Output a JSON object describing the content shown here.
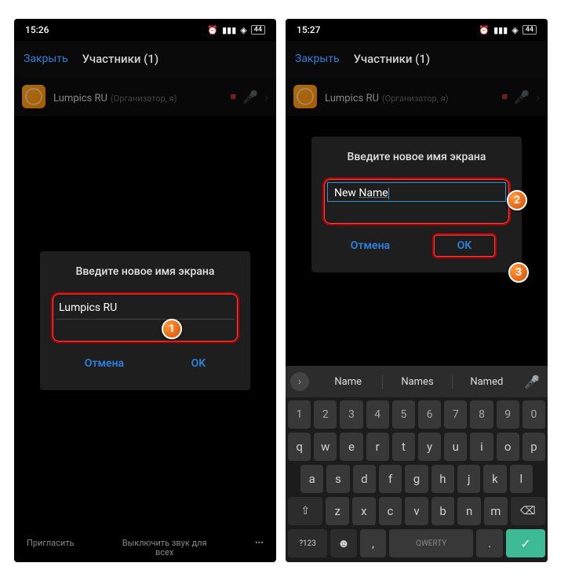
{
  "left": {
    "status": {
      "time": "15:26",
      "battery": "44"
    },
    "closeLabel": "Закрыть",
    "headerTitle": "Участники (1)",
    "participant": {
      "name": "Lumpics RU",
      "meta": "(Организатор, я)"
    },
    "dialogTitle": "Введите новое имя экрана",
    "inputValue": "Lumpics RU",
    "cancelLabel": "Отмена",
    "okLabel": "OK",
    "bottomLeft": "Пригласить",
    "bottomRight": "Выключить звук для всех",
    "calloutNum": "1"
  },
  "right": {
    "status": {
      "time": "15:27",
      "battery": "44"
    },
    "closeLabel": "Закрыть",
    "headerTitle": "Участники (1)",
    "participant": {
      "name": "Lumpics RU",
      "meta": "(Организатор, я)"
    },
    "dialogTitle": "Введите новое имя экрана",
    "inputPart1": "New ",
    "inputPart2": "Name",
    "cancelLabel": "Отмена",
    "okLabel": "OK",
    "callout2": "2",
    "callout3": "3",
    "suggestions": {
      "s1": "Name",
      "s2": "Names",
      "s3": "Named"
    },
    "keys": {
      "row1": [
        "1",
        "2",
        "3",
        "4",
        "5",
        "6",
        "7",
        "8",
        "9",
        "0"
      ],
      "row2": [
        "q",
        "w",
        "e",
        "r",
        "t",
        "y",
        "u",
        "i",
        "o",
        "p"
      ],
      "row3": [
        "a",
        "s",
        "d",
        "f",
        "g",
        "h",
        "j",
        "k",
        "l"
      ],
      "row4": [
        "z",
        "x",
        "c",
        "v",
        "b",
        "n",
        "m"
      ],
      "symKey": "?123",
      "spaceKey": "QWERTY",
      "commaKey": ",",
      "periodKey": "."
    }
  }
}
